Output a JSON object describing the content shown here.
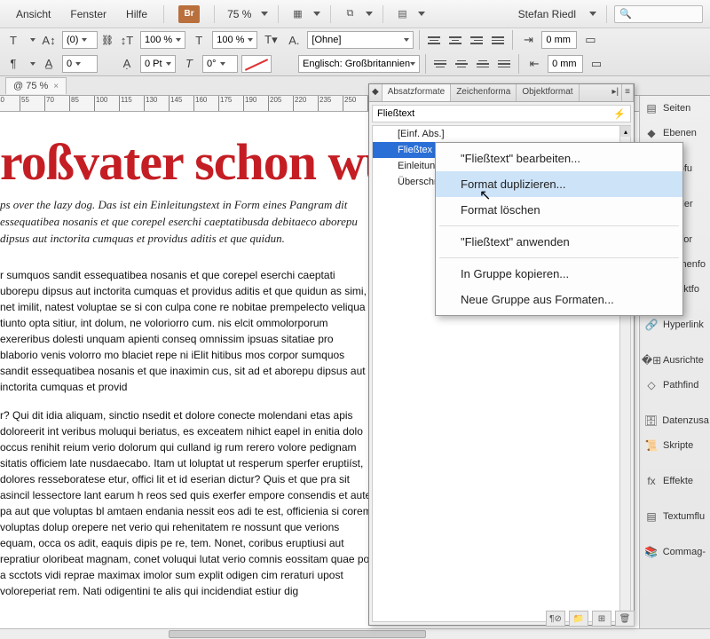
{
  "menubar": {
    "items": [
      "Ansicht",
      "Fenster",
      "Hilfe"
    ],
    "bridge": "Br",
    "zoom": "75 %",
    "user": "Stefan Riedl"
  },
  "controlbar": {
    "row1": {
      "pt_val": "(0)",
      "scale1": "100 %",
      "scale2": "100 %",
      "style_combo": "[Ohne]",
      "indent_top": "0 mm"
    },
    "row2": {
      "leading": "0",
      "tracking": "0 Pt",
      "rotate": "0°",
      "lang": "Englisch: Großbritannien",
      "indent_bot": "0 mm"
    }
  },
  "doctab": {
    "label": "@ 75 %",
    "close": "×"
  },
  "ruler": {
    "start": 40,
    "step": 15,
    "count": 25
  },
  "doc": {
    "headline": "roßvater schon wus",
    "intro": "ps over the lazy dog. Das ist ein Einleitungstext in Form eines Pangram dit essequatibea nosanis et que corepel eserchi caeptatibusda debitaeco aborepu dipsus aut inctorita cumquas et providus aditis et que quidun.",
    "para1": "r sumquos sandit essequatibea nosanis et que corepel eserchi caeptati uborepu dipsus aut inctorita cumquas et providus aditis et que quidun as simi, net imilit, natest voluptae se si con culpa cone re nobitae prempelecto veliqua tiunto opta sitiur, int dolum, ne voloriorro cum. nis elcit ommolorporum exereribus dolesti unquam apienti conseq omnissim ipsuas sitatiae pro blaborio venis volorro mo blaciet repe ni iElit hitibus mos corpor sumquos sandit essequatibea nosanis et que inaximin cus, sit ad et aborepu dipsus aut inctorita cumquas et provid",
    "para2": "r? Qui dit idia aliquam, sinctio nsedit et dolore conecte molendani etas apis doloreerit int veribus moluqui beriatus, es exceatem nihict eapel in enitia dolo occus renihit reium verio dolorum qui culland ig rum rerero volore pedignam sitatis officiem late nusdaecabo. Itam ut loluptat ut resperum sperfer eruptiíst, dolores resseboratese etur, offici lit et id eserian dictur? Quis et que pra sit asincil lessectore lant earum h reos sed quis exerfer empore consendis et aute pa aut que voluptas bl amtaen endania nessit eos adi te est, officienia si corem voluptas dolup orepere net verio qui rehenitatem re nossunt que verions equam, occa os adit, eaquis dipis pe re, tem. Nonet, coribus eruptiusi aut repratiur oloribeat magnam, conet voluqui lutat verio comnis eossitam quae po a scctots vidi reprae maximax imolor sum explit odigen cim reraturi upost voloreperiat rem. Nati odigentini te alis qui incidendiat estiur dig"
  },
  "panel": {
    "tabs": [
      "Absatzformate",
      "Zeichenforma",
      "Objektformat"
    ],
    "active_tab": 0,
    "current": "Fließtext",
    "rows": [
      "[Einf. Abs.]",
      "Fließtex",
      "Einleitung",
      "Überschri"
    ],
    "selected": 1
  },
  "ctxmenu": {
    "items": [
      "\"Fließtext\" bearbeiten...",
      "Format duplizieren...",
      "Format löschen",
      "-",
      "\"Fließtext\" anwenden",
      "-",
      "In Gruppe kopieren...",
      "Neue Gruppe aus Formaten..."
    ],
    "hover": 1
  },
  "dock": {
    "items": [
      {
        "label": "Seiten",
        "gap": false
      },
      {
        "label": "Ebenen",
        "gap": true
      },
      {
        "label": "knüpfu",
        "gap": true
      },
      {
        "label": "ofelder",
        "gap": true
      },
      {
        "label": "satzfor",
        "gap": false
      },
      {
        "label": "Zeichenfo",
        "gap": false
      },
      {
        "label": "Objektfo",
        "gap": true
      },
      {
        "label": "Hyperlink",
        "gap": true
      },
      {
        "label": "Ausrichte",
        "gap": false
      },
      {
        "label": "Pathfind",
        "gap": true
      },
      {
        "label": "Datenzusa",
        "gap": false
      },
      {
        "label": "Skripte",
        "gap": true
      },
      {
        "label": "Effekte",
        "gap": true
      },
      {
        "label": "Textumflu",
        "gap": true
      },
      {
        "label": "Commag-",
        "gap": false
      }
    ]
  }
}
